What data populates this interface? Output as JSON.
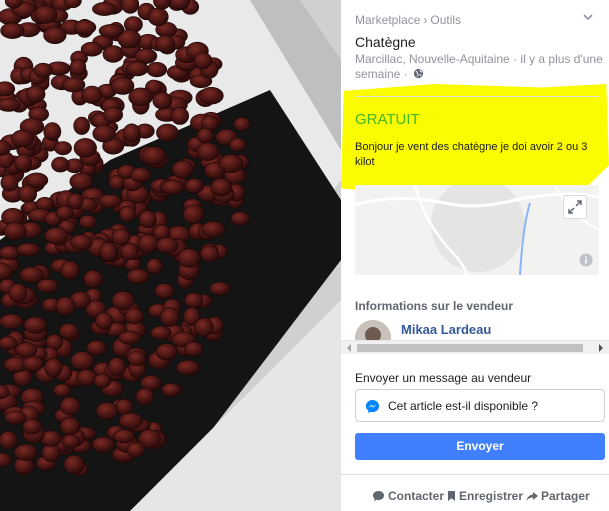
{
  "breadcrumb": {
    "marketplace": "Marketplace",
    "separator": "›",
    "category": "Outils"
  },
  "listing": {
    "title": "Chatègne",
    "location": "Marcillac, Nouvelle-Aquitaine",
    "time_separator": "·",
    "time": "il y a plus d'une semaine",
    "price": "GRATUIT",
    "description": "Bonjour je vent des chatègne je doi avoir 2 ou 3 kilot"
  },
  "seller": {
    "heading": "Informations sur le vendeur",
    "name": "Mikaa Lardeau"
  },
  "message": {
    "heading": "Envoyer un message au vendeur",
    "input_value": "Cet article est-il disponible ?",
    "send_label": "Envoyer"
  },
  "actions": {
    "contact": "Contacter",
    "save": "Enregistrer",
    "share": "Partager"
  },
  "colors": {
    "price": "#42b72a",
    "primary_button": "#4080ff",
    "seller_link": "#365899",
    "highlight": "#fcfc00"
  },
  "icons": [
    "chevron-down-icon",
    "globe-icon",
    "expand-icon",
    "info-icon",
    "messenger-icon",
    "chat-bubble-icon",
    "bookmark-icon",
    "share-arrow-icon"
  ]
}
